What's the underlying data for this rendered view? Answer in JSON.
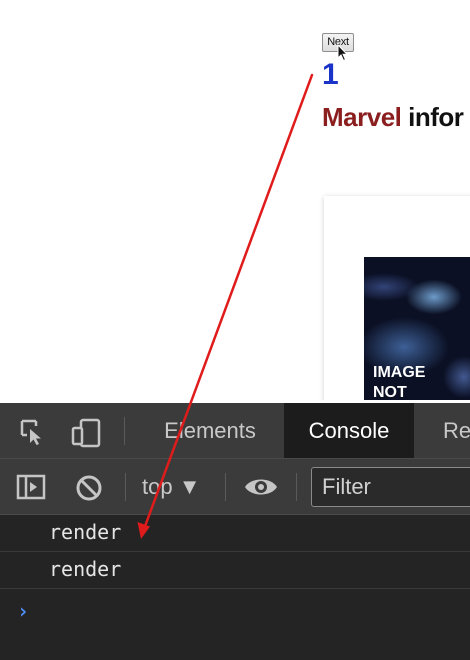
{
  "page": {
    "next_button": "Next",
    "counter": "1",
    "heading_brand": "Marvel",
    "heading_rest": "infor",
    "thumbnail_text_line1": "IMAGE",
    "thumbnail_text_line2": "NOT"
  },
  "devtools": {
    "tabs": [
      {
        "label": "Elements",
        "active": false
      },
      {
        "label": "Console",
        "active": true
      },
      {
        "label": "Re",
        "active": false
      }
    ],
    "context_selector": "top ▼",
    "filter_placeholder": "Filter",
    "console_logs": [
      "render",
      "render"
    ],
    "prompt_symbol": "›"
  },
  "colors": {
    "counter": "#1a33c9",
    "brand_red": "#8b1f1f",
    "annotation_arrow": "#e01b1b",
    "devtools_bg": "#242424",
    "devtools_toolbar": "#3b3b3b",
    "prompt_blue": "#4e8ef7"
  },
  "icons": [
    "pointer-cursor-icon",
    "inspect-element-icon",
    "device-toolbar-icon",
    "sidebar-toggle-icon",
    "clear-console-icon",
    "eye-icon"
  ]
}
